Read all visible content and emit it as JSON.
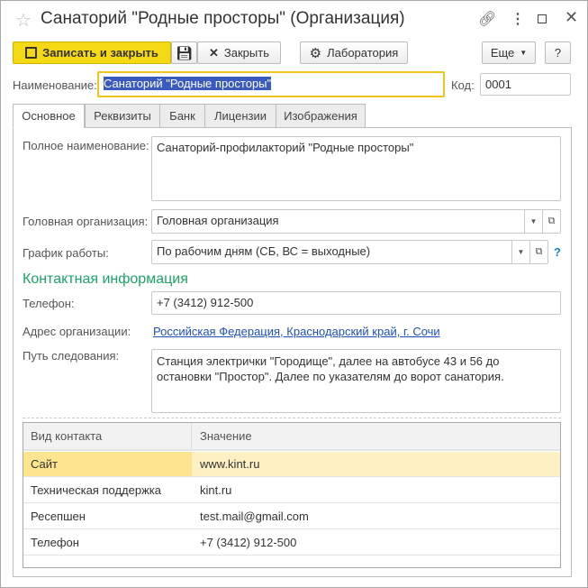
{
  "window": {
    "title": "Санаторий \"Родные просторы\" (Организация)"
  },
  "toolbar": {
    "save_close": "Записать и закрыть",
    "close": "Закрыть",
    "lab": "Лаборатория",
    "more": "Еще",
    "help": "?"
  },
  "header": {
    "name_label": "Наименование:",
    "name_value": "Санаторий \"Родные просторы\"",
    "code_label": "Код:",
    "code_value": "0001"
  },
  "tabs": [
    "Основное",
    "Реквизиты",
    "Банк",
    "Лицензии",
    "Изображения"
  ],
  "form": {
    "full_name_label": "Полное наименование:",
    "full_name": "Санаторий-профилакторий \"Родные просторы\"",
    "head_org_label": "Головная организация:",
    "head_org": "Головная организация",
    "schedule_label": "График работы:",
    "schedule": "По рабочим дням (СБ, ВС = выходные)",
    "schedule_help": "?",
    "contact_header": "Контактная информация",
    "phone_label": "Телефон:",
    "phone": "+7 (3412) 912-500",
    "address_label": "Адрес организации:",
    "address": "Российская Федерация, Краснодарский край, г. Сочи",
    "route_label": "Путь следования:",
    "route": "Станция электрички \"Городище\", далее на автобусе 43 и 56 до остановки \"Простор\". Далее по указателям до ворот санатория."
  },
  "contacts": {
    "headers": [
      "Вид контакта",
      "Значение"
    ],
    "rows": [
      [
        "Сайт",
        "www.kint.ru"
      ],
      [
        "Техническая поддержка",
        "kint.ru"
      ],
      [
        "Ресепшен",
        "test.mail@gmail.com"
      ],
      [
        "Телефон",
        "+7 (3412) 912-500"
      ]
    ]
  }
}
